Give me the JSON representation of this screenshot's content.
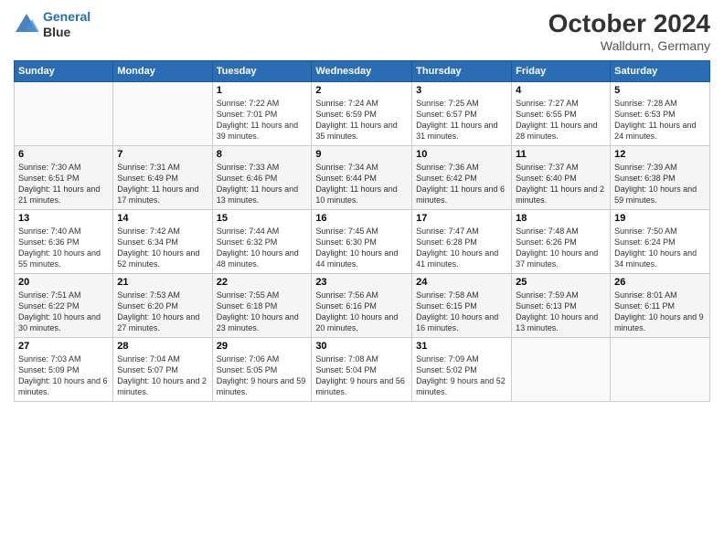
{
  "header": {
    "logo_line1": "General",
    "logo_line2": "Blue",
    "month": "October 2024",
    "location": "Walldurn, Germany"
  },
  "days_of_week": [
    "Sunday",
    "Monday",
    "Tuesday",
    "Wednesday",
    "Thursday",
    "Friday",
    "Saturday"
  ],
  "weeks": [
    [
      {
        "day": "",
        "info": ""
      },
      {
        "day": "",
        "info": ""
      },
      {
        "day": "1",
        "info": "Sunrise: 7:22 AM\nSunset: 7:01 PM\nDaylight: 11 hours and 39 minutes."
      },
      {
        "day": "2",
        "info": "Sunrise: 7:24 AM\nSunset: 6:59 PM\nDaylight: 11 hours and 35 minutes."
      },
      {
        "day": "3",
        "info": "Sunrise: 7:25 AM\nSunset: 6:57 PM\nDaylight: 11 hours and 31 minutes."
      },
      {
        "day": "4",
        "info": "Sunrise: 7:27 AM\nSunset: 6:55 PM\nDaylight: 11 hours and 28 minutes."
      },
      {
        "day": "5",
        "info": "Sunrise: 7:28 AM\nSunset: 6:53 PM\nDaylight: 11 hours and 24 minutes."
      }
    ],
    [
      {
        "day": "6",
        "info": "Sunrise: 7:30 AM\nSunset: 6:51 PM\nDaylight: 11 hours and 21 minutes."
      },
      {
        "day": "7",
        "info": "Sunrise: 7:31 AM\nSunset: 6:49 PM\nDaylight: 11 hours and 17 minutes."
      },
      {
        "day": "8",
        "info": "Sunrise: 7:33 AM\nSunset: 6:46 PM\nDaylight: 11 hours and 13 minutes."
      },
      {
        "day": "9",
        "info": "Sunrise: 7:34 AM\nSunset: 6:44 PM\nDaylight: 11 hours and 10 minutes."
      },
      {
        "day": "10",
        "info": "Sunrise: 7:36 AM\nSunset: 6:42 PM\nDaylight: 11 hours and 6 minutes."
      },
      {
        "day": "11",
        "info": "Sunrise: 7:37 AM\nSunset: 6:40 PM\nDaylight: 11 hours and 2 minutes."
      },
      {
        "day": "12",
        "info": "Sunrise: 7:39 AM\nSunset: 6:38 PM\nDaylight: 10 hours and 59 minutes."
      }
    ],
    [
      {
        "day": "13",
        "info": "Sunrise: 7:40 AM\nSunset: 6:36 PM\nDaylight: 10 hours and 55 minutes."
      },
      {
        "day": "14",
        "info": "Sunrise: 7:42 AM\nSunset: 6:34 PM\nDaylight: 10 hours and 52 minutes."
      },
      {
        "day": "15",
        "info": "Sunrise: 7:44 AM\nSunset: 6:32 PM\nDaylight: 10 hours and 48 minutes."
      },
      {
        "day": "16",
        "info": "Sunrise: 7:45 AM\nSunset: 6:30 PM\nDaylight: 10 hours and 44 minutes."
      },
      {
        "day": "17",
        "info": "Sunrise: 7:47 AM\nSunset: 6:28 PM\nDaylight: 10 hours and 41 minutes."
      },
      {
        "day": "18",
        "info": "Sunrise: 7:48 AM\nSunset: 6:26 PM\nDaylight: 10 hours and 37 minutes."
      },
      {
        "day": "19",
        "info": "Sunrise: 7:50 AM\nSunset: 6:24 PM\nDaylight: 10 hours and 34 minutes."
      }
    ],
    [
      {
        "day": "20",
        "info": "Sunrise: 7:51 AM\nSunset: 6:22 PM\nDaylight: 10 hours and 30 minutes."
      },
      {
        "day": "21",
        "info": "Sunrise: 7:53 AM\nSunset: 6:20 PM\nDaylight: 10 hours and 27 minutes."
      },
      {
        "day": "22",
        "info": "Sunrise: 7:55 AM\nSunset: 6:18 PM\nDaylight: 10 hours and 23 minutes."
      },
      {
        "day": "23",
        "info": "Sunrise: 7:56 AM\nSunset: 6:16 PM\nDaylight: 10 hours and 20 minutes."
      },
      {
        "day": "24",
        "info": "Sunrise: 7:58 AM\nSunset: 6:15 PM\nDaylight: 10 hours and 16 minutes."
      },
      {
        "day": "25",
        "info": "Sunrise: 7:59 AM\nSunset: 6:13 PM\nDaylight: 10 hours and 13 minutes."
      },
      {
        "day": "26",
        "info": "Sunrise: 8:01 AM\nSunset: 6:11 PM\nDaylight: 10 hours and 9 minutes."
      }
    ],
    [
      {
        "day": "27",
        "info": "Sunrise: 7:03 AM\nSunset: 5:09 PM\nDaylight: 10 hours and 6 minutes."
      },
      {
        "day": "28",
        "info": "Sunrise: 7:04 AM\nSunset: 5:07 PM\nDaylight: 10 hours and 2 minutes."
      },
      {
        "day": "29",
        "info": "Sunrise: 7:06 AM\nSunset: 5:05 PM\nDaylight: 9 hours and 59 minutes."
      },
      {
        "day": "30",
        "info": "Sunrise: 7:08 AM\nSunset: 5:04 PM\nDaylight: 9 hours and 56 minutes."
      },
      {
        "day": "31",
        "info": "Sunrise: 7:09 AM\nSunset: 5:02 PM\nDaylight: 9 hours and 52 minutes."
      },
      {
        "day": "",
        "info": ""
      },
      {
        "day": "",
        "info": ""
      }
    ]
  ]
}
